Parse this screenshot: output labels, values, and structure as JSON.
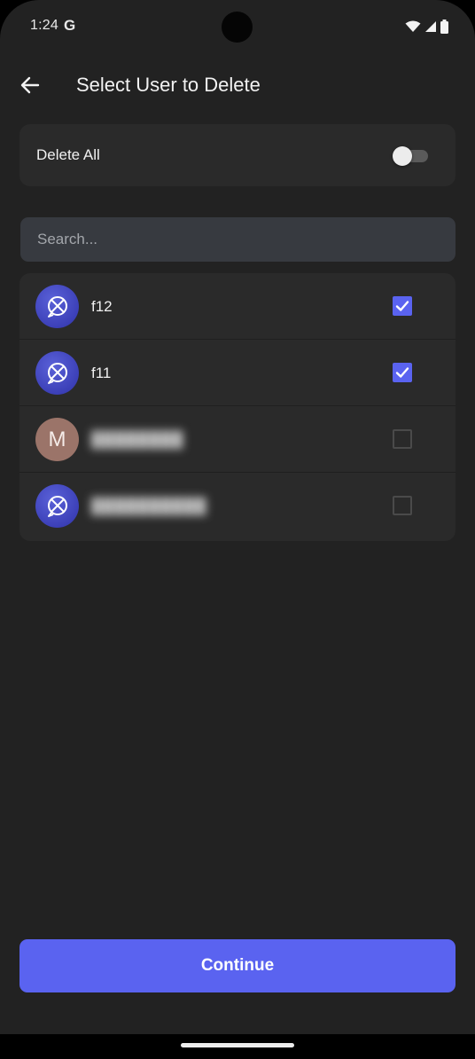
{
  "status_bar": {
    "time": "1:24",
    "g_label": "G",
    "icons": [
      "wifi-icon",
      "signal-icon",
      "battery-icon"
    ]
  },
  "header": {
    "title": "Select User to Delete",
    "back_icon": "arrow-left-icon"
  },
  "delete_all": {
    "label": "Delete All",
    "enabled": false
  },
  "search": {
    "placeholder": "Search...",
    "value": ""
  },
  "users": [
    {
      "name": "f12",
      "avatar_type": "logo",
      "avatar_icon": "ringcentral-logo-icon",
      "checked": true,
      "name_blurred": false
    },
    {
      "name": "f11",
      "avatar_type": "logo",
      "avatar_icon": "ringcentral-logo-icon",
      "checked": true,
      "name_blurred": false
    },
    {
      "name": "",
      "avatar_type": "letter",
      "avatar_letter": "M",
      "checked": false,
      "name_blurred": true
    },
    {
      "name": "",
      "avatar_type": "logo",
      "avatar_icon": "ringcentral-logo-icon",
      "checked": false,
      "name_blurred": true
    }
  ],
  "continue_button": {
    "label": "Continue"
  },
  "colors": {
    "background": "#222222",
    "card": "#2a2a2a",
    "search_field": "#373a40",
    "accent": "#5a63f0",
    "avatar_logo": "#3c40b8",
    "avatar_letter": "#9b7469"
  }
}
